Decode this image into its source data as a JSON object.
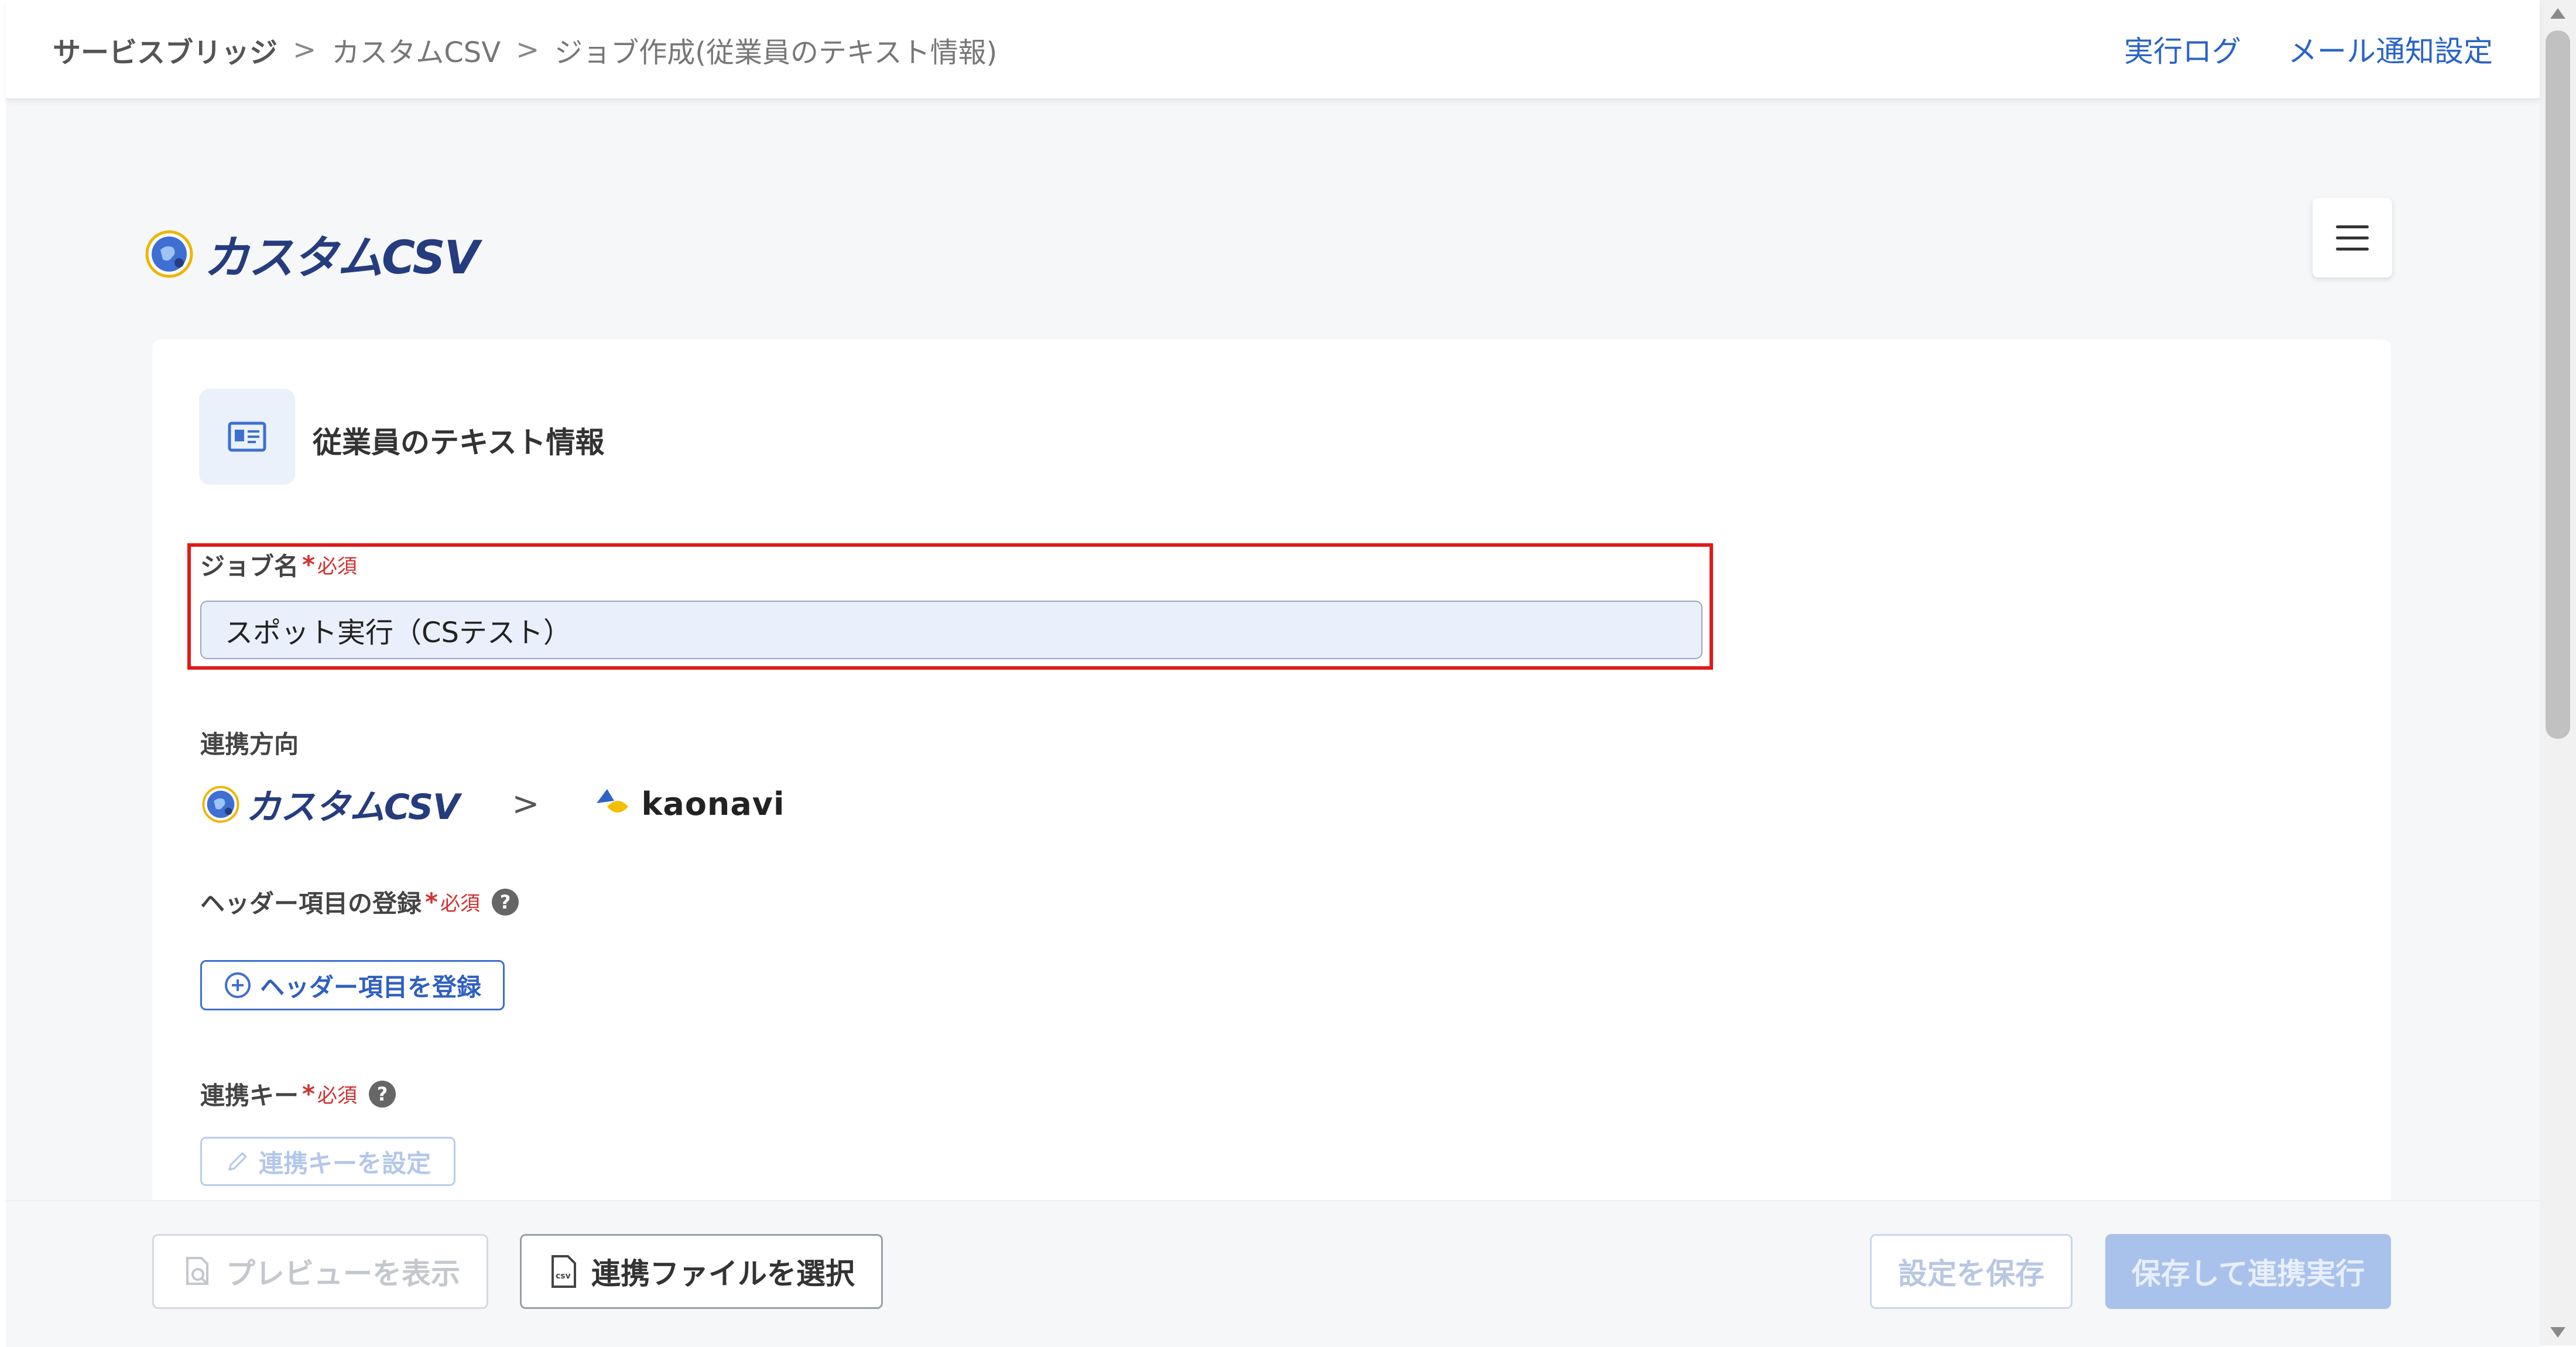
{
  "breadcrumb": {
    "items": [
      "サービスブリッジ",
      "カスタムCSV",
      "ジョブ作成(従業員のテキスト情報)"
    ],
    "separator": ">"
  },
  "header_links": {
    "log": "実行ログ",
    "mail": "メール通知設定"
  },
  "app_logo_text": "カスタムCSV",
  "card": {
    "title": "従業員のテキスト情報"
  },
  "job_name": {
    "label": "ジョブ名",
    "required_mark": "*",
    "required_text": "必須",
    "value": "スポット実行（CSテスト）"
  },
  "flow": {
    "label": "連携方向",
    "source": "カスタムCSV",
    "arrow": ">",
    "target": "kaonavi"
  },
  "header_items": {
    "label": "ヘッダー項目の登録",
    "required_mark": "*",
    "required_text": "必須",
    "help": "?",
    "button": "ヘッダー項目を登録"
  },
  "link_key": {
    "label": "連携キー",
    "required_mark": "*",
    "required_text": "必須",
    "help": "?",
    "button": "連携キーを設定"
  },
  "footer": {
    "preview": "プレビューを表示",
    "select_file": "連携ファイルを選択",
    "save": "設定を保存",
    "save_run": "保存して連携実行"
  },
  "colors": {
    "accent": "#2a64c5",
    "logo": "#253c7e",
    "required": "#d32f2f",
    "highlight": "#e01a1a"
  }
}
